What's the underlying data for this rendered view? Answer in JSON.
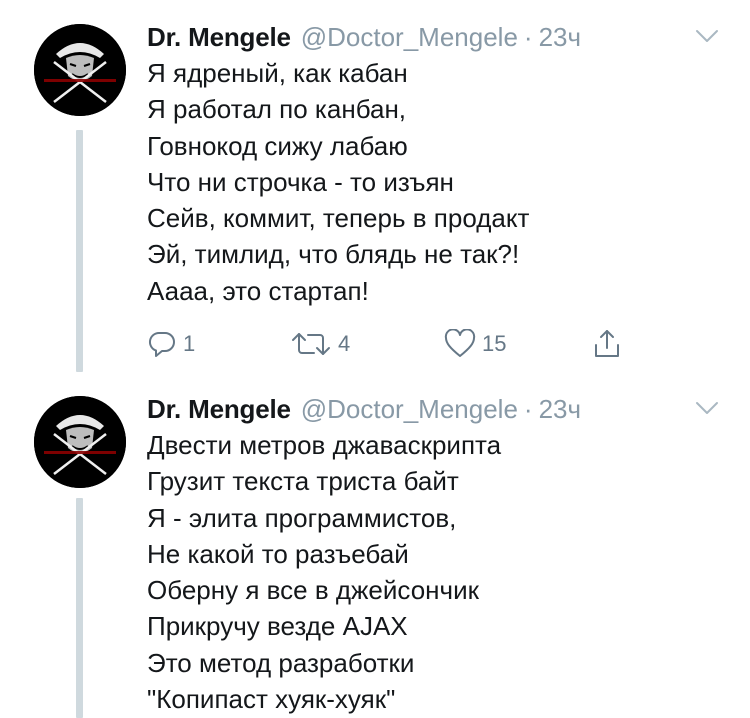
{
  "tweets": [
    {
      "display_name": "Dr. Mengele",
      "handle": "@Doctor_Mengele",
      "separator": "·",
      "time": "23ч",
      "lines": [
        "Я ядреный, как кабан",
        "Я работал по канбан,",
        "Говнокод сижу лабаю",
        "Что ни строчка - то изъян",
        "Сейв, коммит, теперь в продакт",
        "Эй, тимлид, что блядь не так?!",
        "Аааа, это стартап!"
      ],
      "actions": {
        "reply_count": "1",
        "retweet_count": "4",
        "like_count": "15"
      }
    },
    {
      "display_name": "Dr. Mengele",
      "handle": "@Doctor_Mengele",
      "separator": "·",
      "time": "23ч",
      "lines": [
        "Двести метров джаваскрипта",
        "Грузит текста триста байт",
        "Я - элита программистов,",
        "Не какой то разъебай",
        "Оберну я все в джейсончик",
        "Прикручу везде AJAX",
        "Это метод разработки",
        "\"Копипаст хуяк-хуяк\""
      ]
    }
  ],
  "icons": {
    "reply": "reply-icon",
    "retweet": "retweet-icon",
    "like": "heart-icon",
    "share": "share-icon",
    "caret": "chevron-down-icon"
  },
  "colors": {
    "text": "#14171a",
    "secondary": "#8899a6",
    "action": "#657786",
    "thread_line": "#cfd9de"
  }
}
